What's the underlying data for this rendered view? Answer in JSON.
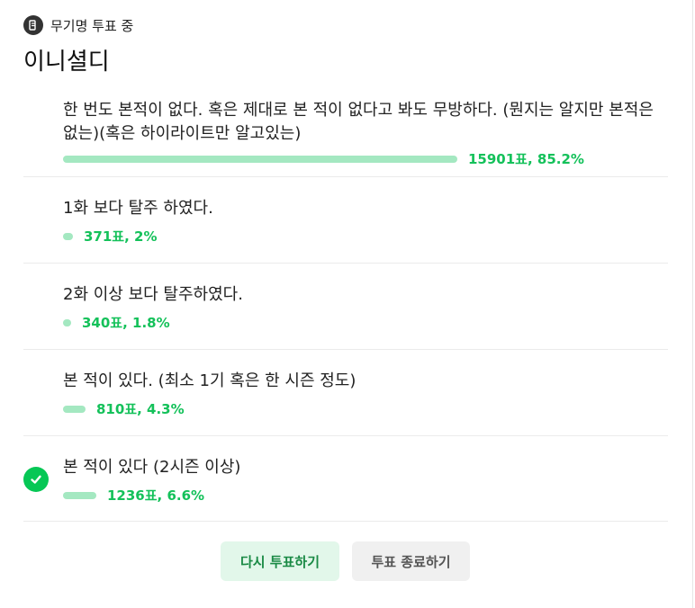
{
  "header": {
    "label": "무기명 투표 중",
    "icon": "poll-icon"
  },
  "title": "이니셜디",
  "options": [
    {
      "text": "한 번도 본적이 없다. 혹은 제대로 본 적이 없다고 봐도 무방하다. (뭔지는 알지만 본적은 없는)(혹은 하이라이트만 알고있는)",
      "result": "15901표, 85.2%",
      "percent": 85.2,
      "selected": false
    },
    {
      "text": "1화 보다 탈주 하였다.",
      "result": "371표, 2%",
      "percent": 2,
      "selected": false
    },
    {
      "text": "2화 이상 보다 탈주하였다.",
      "result": "340표, 1.8%",
      "percent": 1.8,
      "selected": false
    },
    {
      "text": "본 적이 있다. (최소 1기 혹은 한 시즌 정도)",
      "result": "810표, 4.3%",
      "percent": 4.3,
      "selected": false
    },
    {
      "text": "본 적이 있다 (2시즌 이상)",
      "result": "1236표, 6.6%",
      "percent": 6.6,
      "selected": true
    }
  ],
  "buttons": {
    "revote": "다시 투표하기",
    "end": "투표 종료하기"
  },
  "colors": {
    "bar": "#a4e8c1",
    "result": "#14c15a",
    "check": "#06c755"
  }
}
